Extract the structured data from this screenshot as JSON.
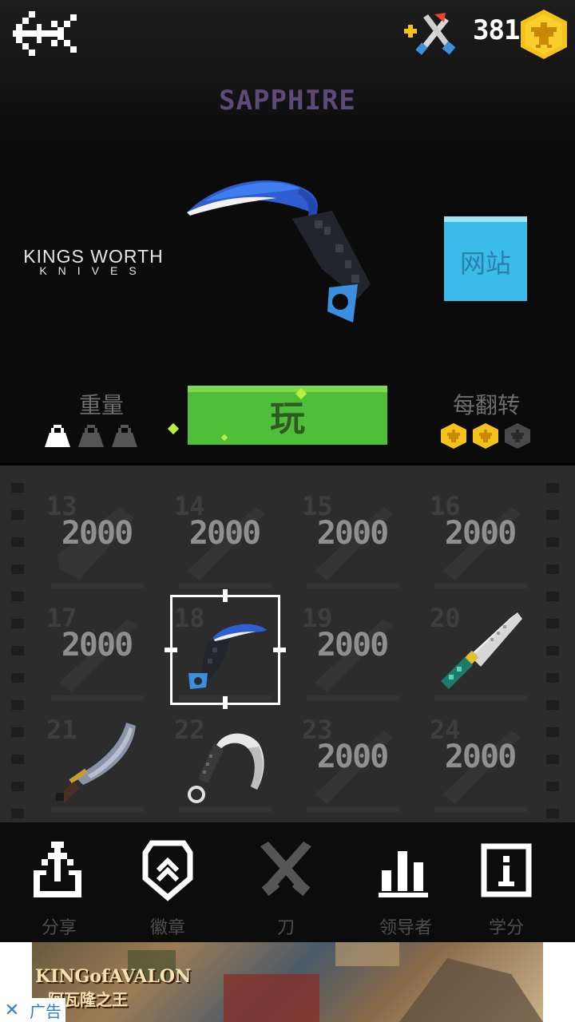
{
  "header": {
    "coins": "381",
    "knife_name": "SAPPHIRE"
  },
  "brand": {
    "line1": "KINGS WORTH",
    "line2": "KNIVES"
  },
  "website_label": "网站",
  "stats": {
    "weight_label": "重量",
    "weight_level": 1,
    "weight_max": 3,
    "flip_label": "每翻转",
    "flip_coins": 2,
    "flip_max": 3
  },
  "play_label": "玩",
  "grid": {
    "cells": [
      {
        "num": "13",
        "price": "2000"
      },
      {
        "num": "14",
        "price": "2000"
      },
      {
        "num": "15",
        "price": "2000"
      },
      {
        "num": "16",
        "price": "2000"
      },
      {
        "num": "17",
        "price": "2000"
      },
      {
        "num": "18",
        "price": ""
      },
      {
        "num": "19",
        "price": "2000"
      },
      {
        "num": "20",
        "price": ""
      },
      {
        "num": "21",
        "price": ""
      },
      {
        "num": "22",
        "price": ""
      },
      {
        "num": "23",
        "price": "2000"
      },
      {
        "num": "24",
        "price": "2000"
      }
    ],
    "selected": "18"
  },
  "nav": {
    "share": "分享",
    "badges": "徽章",
    "knives": "刀",
    "leaders": "领导者",
    "credits": "学分"
  },
  "ad": {
    "title_en": "KINGofAVALON",
    "title_cn": "阿瓦隆之王",
    "close": "✕",
    "label": "广告"
  },
  "colors": {
    "play": "#4fbf3a",
    "website": "#3bbbe9",
    "coin": "#f5c21c",
    "title": "#5c4a78"
  }
}
